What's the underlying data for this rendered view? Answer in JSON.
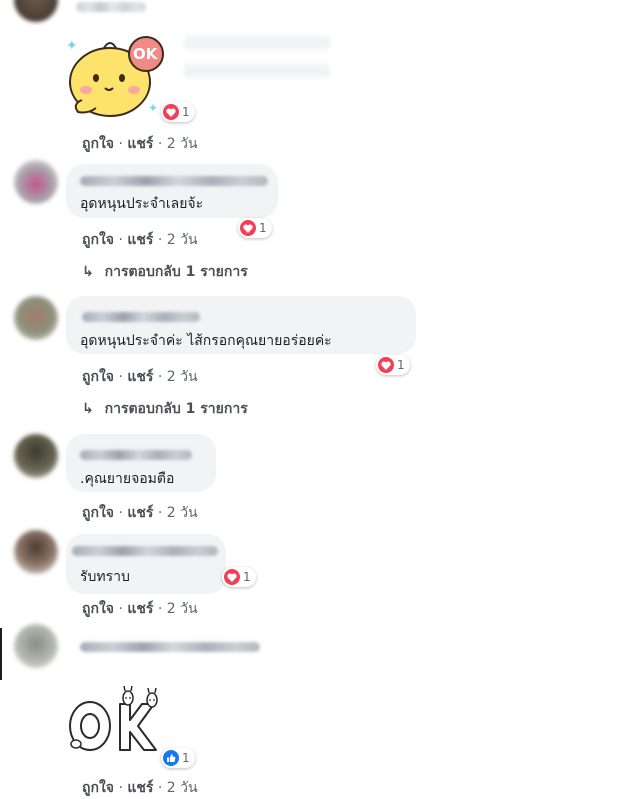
{
  "comments": [
    {
      "text": "",
      "meta": {
        "like": "ถูกใจ",
        "sep1": "·",
        "share": "แชร์",
        "time": "· 2 วัน"
      },
      "reaction": {
        "type": "love",
        "count": "1"
      }
    },
    {
      "text": "อุดหนุนประจำเลยจ้ะ",
      "meta": {
        "like": "ถูกใจ",
        "sep1": "·",
        "share": "แชร์",
        "time": "· 2 วัน"
      },
      "reaction": {
        "type": "love",
        "count": "1"
      },
      "reply": "การตอบกลับ 1 รายการ"
    },
    {
      "text": "อุดหนุนประจำค่ะ ไส้กรอกคุณยายอร่อยค่ะ",
      "meta": {
        "like": "ถูกใจ",
        "sep1": "·",
        "share": "แชร์",
        "time": "· 2 วัน"
      },
      "reaction": {
        "type": "love",
        "count": "1"
      },
      "reply": "การตอบกลับ 1 รายการ"
    },
    {
      "text": ".คุณยายจอมตือ",
      "meta": {
        "like": "ถูกใจ",
        "sep1": "·",
        "share": "แชร์",
        "time": "· 2 วัน"
      }
    },
    {
      "text": "รับทราบ",
      "meta": {
        "like": "ถูกใจ",
        "sep1": "·",
        "share": "แชร์",
        "time": "· 2 วัน"
      },
      "reaction": {
        "type": "love",
        "count": "1"
      }
    },
    {
      "text": "",
      "meta": {
        "like": "ถูกใจ",
        "sep1": "·",
        "share": "แชร์",
        "time": "· 2 วัน"
      },
      "reaction": {
        "type": "like",
        "count": "1"
      }
    }
  ],
  "sticker_ok_text": "OK",
  "colors": {
    "love": "#f33e58",
    "like": "#1877f2",
    "bubble": "#f2f3f5",
    "meta": "#606770"
  }
}
